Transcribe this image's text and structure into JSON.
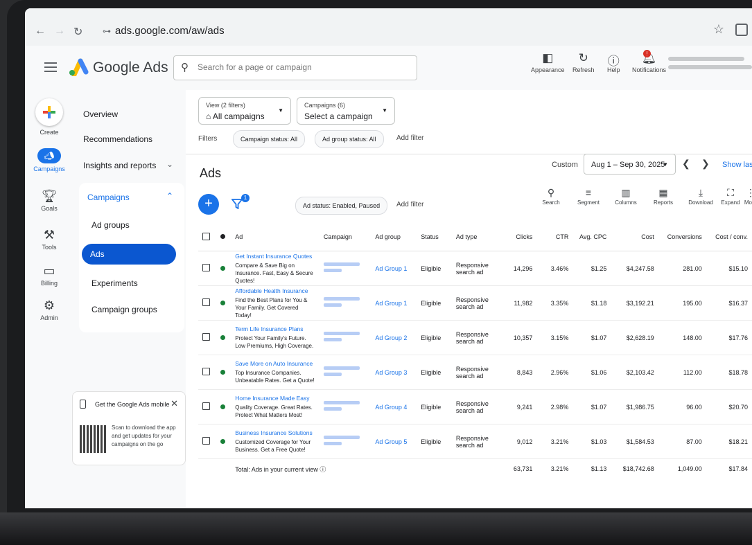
{
  "browser": {
    "url": "ads.google.com/aw/ads",
    "back_icon": "arrow-left-icon",
    "forward_icon": "arrow-right-icon",
    "reload_icon": "refresh-icon"
  },
  "header": {
    "brand": "Google Ads",
    "search_placeholder": "Search for a page or campaign",
    "buttons": [
      {
        "label": "Appearance",
        "icon": "appearance-icon"
      },
      {
        "label": "Refresh",
        "icon": "refresh-icon"
      },
      {
        "label": "Help",
        "icon": "help-icon"
      },
      {
        "label": "Notifications",
        "icon": "bell-icon",
        "badge": "!"
      }
    ]
  },
  "rail": [
    {
      "label": "Create"
    },
    {
      "label": "Campaigns"
    },
    {
      "label": "Goals"
    },
    {
      "label": "Tools"
    },
    {
      "label": "Billing"
    },
    {
      "label": "Admin"
    }
  ],
  "nav": {
    "items": [
      "Overview",
      "Recommendations",
      "Insights and reports",
      "Campaigns",
      "Ad groups",
      "Ads",
      "Experiments",
      "Campaign groups"
    ]
  },
  "mobile_card": {
    "title": "Get the Google Ads mobile",
    "desc": "Scan to download the app and get updates for your campaigns on the go"
  },
  "filters_bar": {
    "view_small": "View (2 filters)",
    "view_big": "All campaigns",
    "campaigns_small": "Campaigns (6)",
    "campaigns_big": "Select a campaign",
    "filters_label": "Filters",
    "chip_campaign_status": "Campaign status: All",
    "chip_adgroup_status": "Ad group status: All",
    "add_filter": "Add filter"
  },
  "page": {
    "title": "Ads",
    "custom": "Custom",
    "date_range": "Aug 1 – Sep 30, 2025",
    "show_last": "Show last",
    "funnel_badge": "1",
    "ad_status_chip": "Ad status: Enabled, Paused",
    "add_filter": "Add filter"
  },
  "toolbar": [
    "Search",
    "Segment",
    "Columns",
    "Reports",
    "Download",
    "Expand",
    "More"
  ],
  "table": {
    "headers": {
      "ad": "Ad",
      "campaign": "Campaign",
      "ad_group": "Ad group",
      "status": "Status",
      "ad_type": "Ad type",
      "clicks": "Clicks",
      "ctr": "CTR",
      "avg_cpc": "Avg. CPC",
      "cost": "Cost",
      "conversions": "Conversions",
      "cost_conv": "Cost / conv."
    },
    "rows": [
      {
        "headline": "Get Instant Insurance Quotes",
        "desc": "Compare & Save Big on Insurance. Fast, Easy & Secure Quotes!",
        "ad_group": "Ad Group 1",
        "status": "Eligible",
        "ad_type": "Responsive search ad",
        "clicks": "14,296",
        "ctr": "3.46%",
        "cpc": "$1.25",
        "cost": "$4,247.58",
        "conv": "281.00",
        "cpa": "$15.10"
      },
      {
        "headline": "Affordable Health Insurance",
        "desc": "Find the Best Plans for You & Your Family. Get Covered Today!",
        "ad_group": "Ad Group 1",
        "status": "Eligible",
        "ad_type": "Responsive search ad",
        "clicks": "11,982",
        "ctr": "3.35%",
        "cpc": "$1.18",
        "cost": "$3,192.21",
        "conv": "195.00",
        "cpa": "$16.37"
      },
      {
        "headline": "Term Life Insurance Plans",
        "desc": "Protect Your Family's Future. Low Premiums, High Coverage.",
        "ad_group": "Ad Group 2",
        "status": "Eligible",
        "ad_type": "Responsive search ad",
        "clicks": "10,357",
        "ctr": "3.15%",
        "cpc": "$1.07",
        "cost": "$2,628.19",
        "conv": "148.00",
        "cpa": "$17.76"
      },
      {
        "headline": "Save More on Auto Insurance",
        "desc": "Top Insurance Companies. Unbeatable Rates. Get a Quote!",
        "ad_group": "Ad Group 3",
        "status": "Eligible",
        "ad_type": "Responsive search ad",
        "clicks": "8,843",
        "ctr": "2.96%",
        "cpc": "$1.06",
        "cost": "$2,103.42",
        "conv": "112.00",
        "cpa": "$18.78"
      },
      {
        "headline": "Home Insurance Made Easy",
        "desc": "Quality Coverage. Great Rates. Protect What Matters Most!",
        "ad_group": "Ad Group 4",
        "status": "Eligible",
        "ad_type": "Responsive search ad",
        "clicks": "9,241",
        "ctr": "2.98%",
        "cpc": "$1.07",
        "cost": "$1,986.75",
        "conv": "96.00",
        "cpa": "$20.70"
      },
      {
        "headline": "Business Insurance Solutions",
        "desc": "Customized Coverage for Your Business. Get a Free Quote!",
        "ad_group": "Ad Group 5",
        "status": "Eligible",
        "ad_type": "Responsive search ad",
        "clicks": "9,012",
        "ctr": "3.21%",
        "cpc": "$1.03",
        "cost": "$1,584.53",
        "conv": "87.00",
        "cpa": "$18.21"
      }
    ],
    "total": {
      "label": "Total: Ads in your current view",
      "clicks": "63,731",
      "ctr": "3.21%",
      "cpc": "$1.13",
      "cost": "$18,742.68",
      "conv": "1,049.00",
      "cpa": "$17.84"
    }
  },
  "colors": {
    "accent": "#1a73e8",
    "active_nav": "#0b57d0",
    "enabled_dot": "#188038",
    "notification": "#d93025"
  }
}
